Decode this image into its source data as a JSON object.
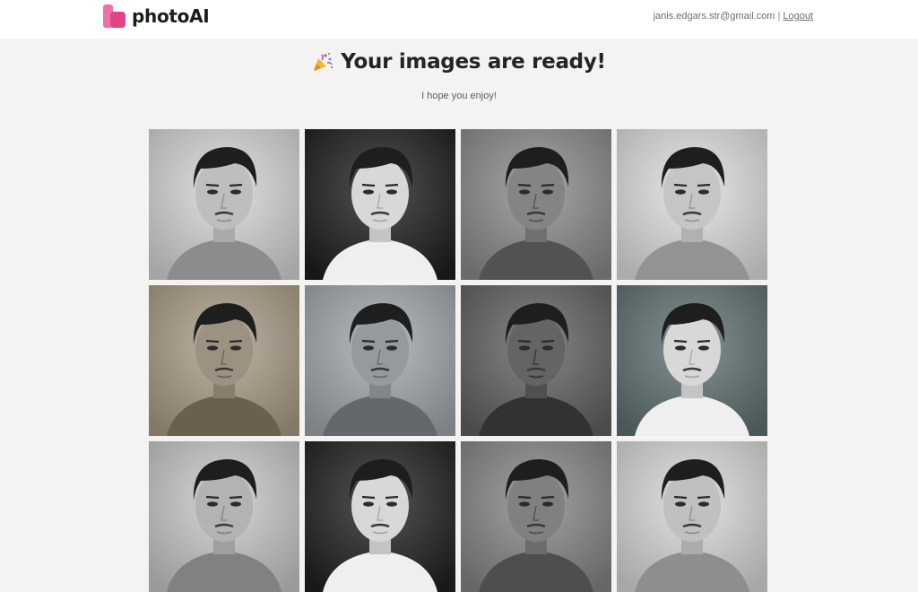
{
  "header": {
    "logo_text": "photoAI",
    "logo_icon": "photoai-logo-icon",
    "user_email": "janis.edgars.str@gmail.com",
    "separator": "|",
    "logout_label": "Logout"
  },
  "main": {
    "title_icon": "party-popper-icon",
    "title": "Your images are ready!",
    "subtitle": "I hope you enjoy!"
  },
  "gallery": {
    "images": [
      {
        "description": "eyes-closed-white-shirt",
        "tone": "#c8c8c8"
      },
      {
        "description": "white-shirt-dark-bg",
        "tone": "#3a3a3a"
      },
      {
        "description": "suit-jacket-grey-bg",
        "tone": "#8e8e8e"
      },
      {
        "description": "close-up-light-bg",
        "tone": "#cfcfcf"
      },
      {
        "description": "sepia-dark-shirt",
        "tone": "#a79b8c"
      },
      {
        "description": "brown-jacket-color",
        "tone": "#9ea4a8"
      },
      {
        "description": "grey-suit-monochrome",
        "tone": "#6e6e6e"
      },
      {
        "description": "close-up-color-teal-bg",
        "tone": "#6d7a7c"
      },
      {
        "description": "row-3-1",
        "tone": "#bdbdbd"
      },
      {
        "description": "row-3-2",
        "tone": "#3c3c3c"
      },
      {
        "description": "row-3-3",
        "tone": "#8a8a8a"
      },
      {
        "description": "row-3-4",
        "tone": "#cacaca"
      }
    ]
  },
  "colors": {
    "brand": "#e8528f",
    "background": "#f4f3f2",
    "header_bg": "#ffffff"
  }
}
